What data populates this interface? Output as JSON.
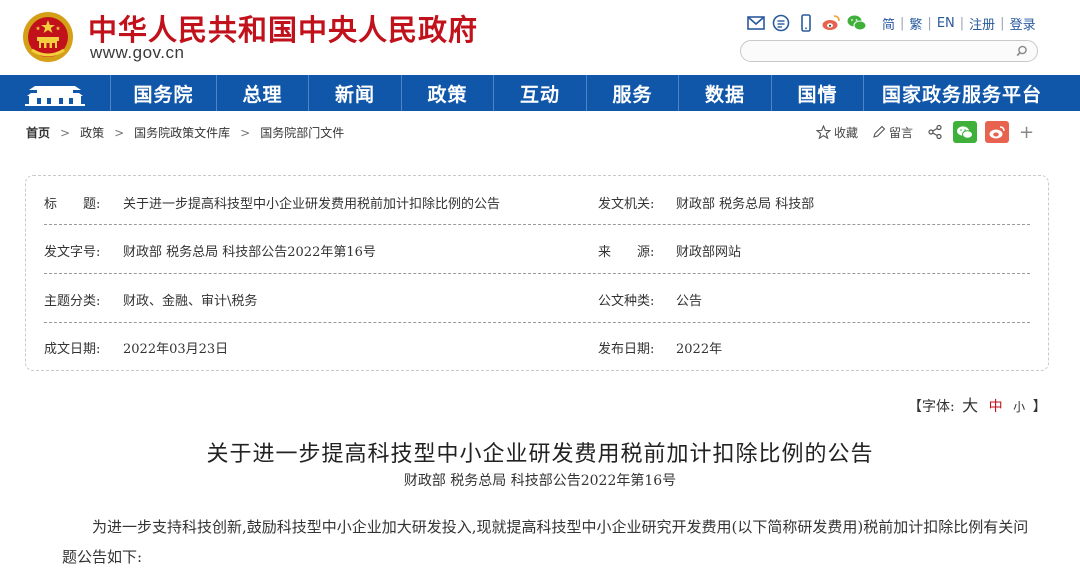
{
  "header": {
    "site_title": "中华人民共和国中央人民政府",
    "site_url": "www.gov.cn",
    "top_links": [
      "简",
      "繁",
      "EN",
      "注册",
      "登录"
    ],
    "search_placeholder": "",
    "tool_icons": [
      "mail-icon",
      "message-icon",
      "mobile-icon",
      "weibo-icon",
      "wechat-icon"
    ]
  },
  "nav": {
    "items": [
      "国务院",
      "总理",
      "新闻",
      "政策",
      "互动",
      "服务",
      "数据",
      "国情",
      "国家政务服务平台"
    ]
  },
  "breadcrumb": [
    "首页",
    "政策",
    "国务院政策文件库",
    "国务院部门文件"
  ],
  "actions": {
    "favorite": "收藏",
    "comment": "留言"
  },
  "info": {
    "title_label": "标　　题:",
    "title_value": "关于进一步提高科技型中小企业研发费用税前加计扣除比例的公告",
    "issuer_label": "发文机关:",
    "issuer_value": "财政部  税务总局  科技部",
    "docno_label": "发文字号:",
    "docno_value": "财政部  税务总局  科技部公告2022年第16号",
    "source_label": "来　　源:",
    "source_value": "财政部网站",
    "topic_label": "主题分类:",
    "topic_value": "财政、金融、审计\\税务",
    "doctype_label": "公文种类:",
    "doctype_value": "公告",
    "written_label": "成文日期:",
    "written_value": "2022年03月23日",
    "published_label": "发布日期:",
    "published_value": "2022年"
  },
  "fontsize": {
    "prefix": "【字体:",
    "large": "大",
    "medium": "中",
    "small": "小",
    "suffix": "】"
  },
  "article": {
    "title": "关于进一步提高科技型中小企业研发费用税前加计扣除比例的公告",
    "subtitle": "财政部  税务总局  科技部公告2022年第16号",
    "body": "为进一步支持科技创新,鼓励科技型中小企业加大研发投入,现就提高科技型中小企业研究开发费用(以下简称研发费用)税前加计扣除比例有关问题公告如下:"
  },
  "colors": {
    "brand_red": "#c1121c",
    "nav_blue": "#1157a9",
    "wechat_green": "#3fb13b",
    "weibo_red": "#e8634f"
  }
}
